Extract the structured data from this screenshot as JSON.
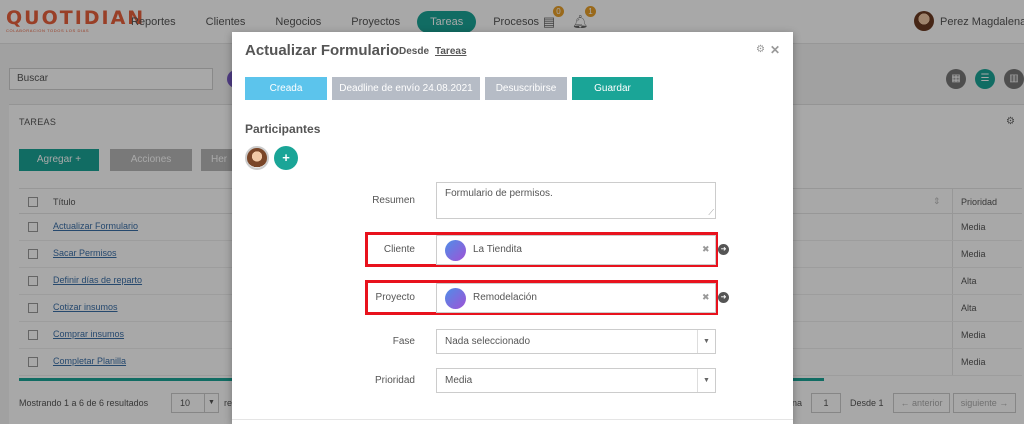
{
  "brand": {
    "logo": "QUOTIDIAN",
    "tagline": "COLABORACION TODOS LOS DIAS"
  },
  "nav": {
    "items": [
      {
        "label": "Reportes"
      },
      {
        "label": "Clientes"
      },
      {
        "label": "Negocios"
      },
      {
        "label": "Proyectos"
      },
      {
        "label": "Tareas",
        "active": true
      },
      {
        "label": "Procesos"
      }
    ],
    "messages_badge": "0",
    "notifications_badge": "1",
    "user_name": "Perez Magdalena",
    "icons": [
      "inbox-icon",
      "bell-icon",
      "chevron-down-icon"
    ]
  },
  "page": {
    "search_placeholder": "Buscar",
    "panel_title": "TAREAS",
    "add_button": "Agregar +",
    "actions_button": "Acciones",
    "tools_fragment": "Her",
    "table": {
      "header_title": "Título",
      "header_priority": "Prioridad",
      "rows": [
        {
          "title": "Actualizar Formulario",
          "priority": "Media"
        },
        {
          "title": "Sacar Permisos",
          "priority": "Media"
        },
        {
          "title": "Definir días de reparto",
          "priority": "Alta"
        },
        {
          "title": "Cotizar insumos",
          "priority": "Alta"
        },
        {
          "title": "Comprar insumos",
          "priority": "Media"
        },
        {
          "title": "Completar Planilla",
          "priority": "Media"
        }
      ]
    },
    "footer": {
      "results_text": "Mostrando 1 a 6 de 6 resultados",
      "page_size": "10",
      "results_suffix": "re",
      "page_label_fragment": "na",
      "page_input": "1",
      "of_pages": "Desde 1",
      "prev_button": "← anterior",
      "next_button": "siguiente →"
    }
  },
  "modal": {
    "title": "Actualizar Formulario",
    "from_label": "Desde",
    "from_link": "Tareas",
    "buttons": {
      "status": "Creada",
      "deadline": "Deadline de envío 24.08.2021",
      "unsubscribe": "Desuscribirse",
      "save": "Guardar"
    },
    "participants_label": "Participantes",
    "add_participant": "+",
    "fields": {
      "summary_label": "Resumen",
      "summary_value": "Formulario de permisos.",
      "client_label": "Cliente",
      "client_value": "La Tiendita",
      "project_label": "Proyecto",
      "project_value": "Remodelación",
      "phase_label": "Fase",
      "phase_value": "Nada seleccionado",
      "priority_label": "Prioridad",
      "priority_value": "Media"
    },
    "highlight_color": "#e8121d"
  },
  "colors": {
    "accent": "#1aa597",
    "status_blue": "#5cc4ec",
    "muted_button": "#b6bcc6",
    "logo": "#e8603c"
  }
}
